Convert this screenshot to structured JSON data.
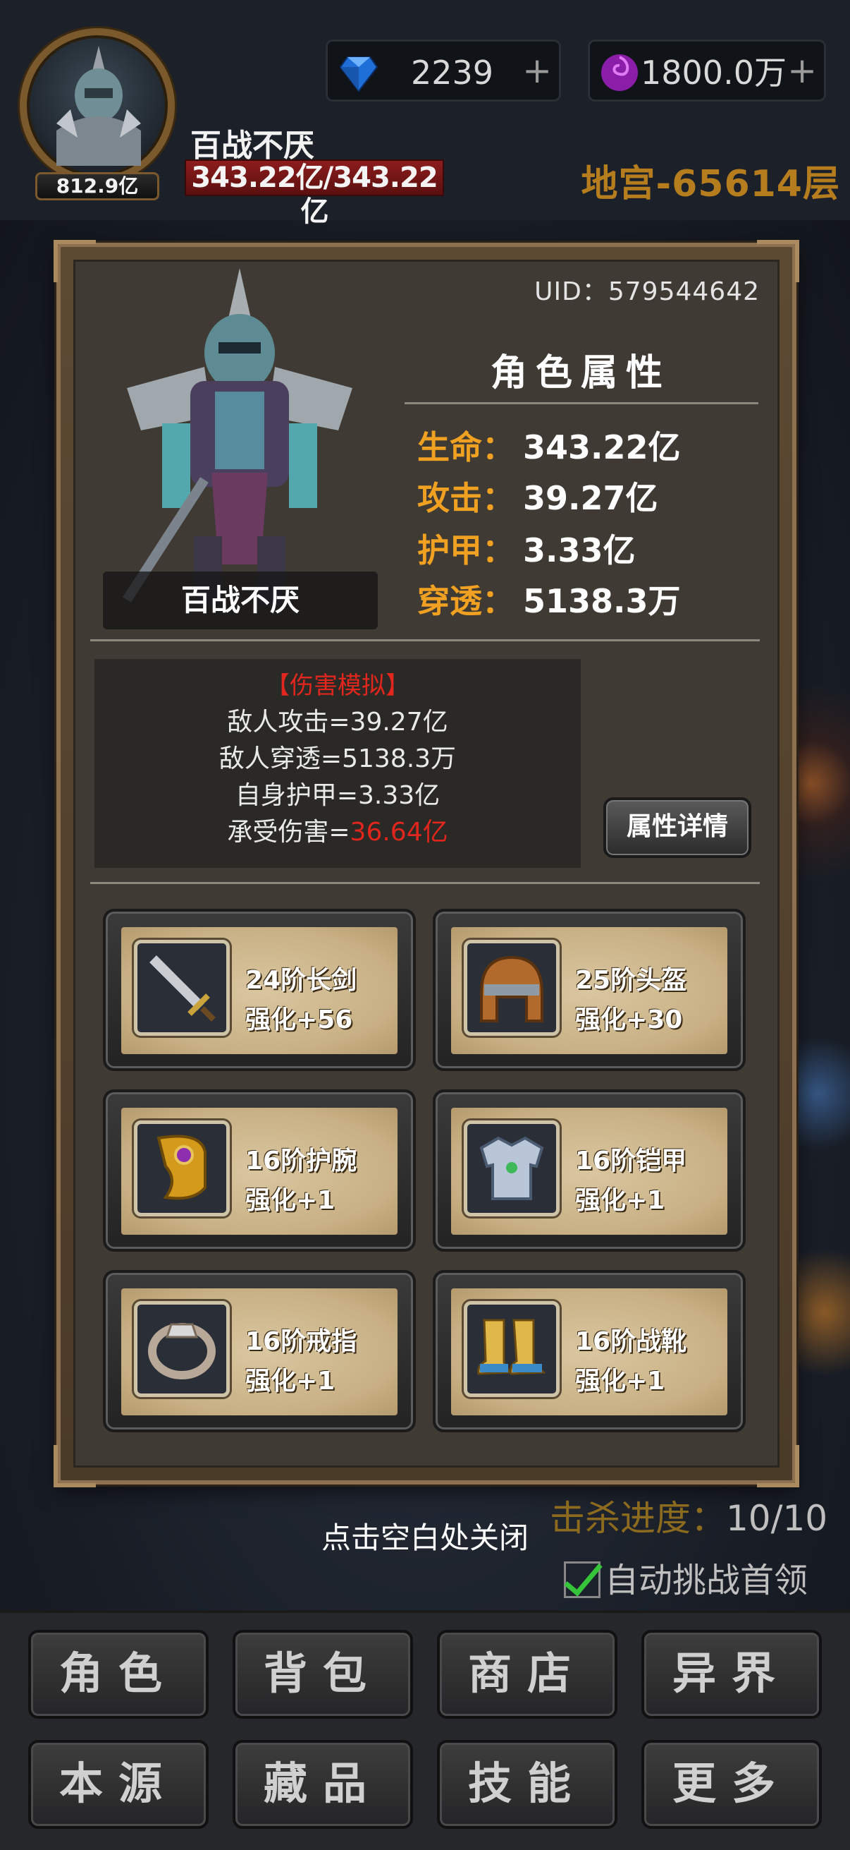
{
  "header": {
    "avatar_level": "812.9亿",
    "player_name": "百战不厌",
    "hp": "343.22亿/343.22亿",
    "gems": "2239",
    "gems_plus": "+",
    "essence": "1800.0万",
    "essence_plus": "+",
    "floor": "地宫-65614层"
  },
  "panel": {
    "uid": "UID：579544642",
    "hero_name": "百战不厌",
    "attr_title": "角色属性",
    "attributes": [
      {
        "label": "生命：",
        "value": "343.22亿"
      },
      {
        "label": "攻击：",
        "value": "39.27亿"
      },
      {
        "label": "护甲：",
        "value": "3.33亿"
      },
      {
        "label": "穿透：",
        "value": "5138.3万"
      }
    ],
    "damage_sim": {
      "title": "【伤害模拟】",
      "enemy_attack": "敌人攻击=39.27亿",
      "enemy_penetration": "敌人穿透=5138.3万",
      "self_armor": "自身护甲=3.33亿",
      "damage_label": "承受伤害=",
      "damage_value": "36.64亿"
    },
    "detail_button": "属性详情",
    "equipment": [
      {
        "name": "24阶长剑",
        "level": "强化+56",
        "icon": "sword-icon"
      },
      {
        "name": "25阶头盔",
        "level": "强化+30",
        "icon": "helmet-icon"
      },
      {
        "name": "16阶护腕",
        "level": "强化+1",
        "icon": "bracer-icon"
      },
      {
        "name": "16阶铠甲",
        "level": "强化+1",
        "icon": "armor-icon"
      },
      {
        "name": "16阶戒指",
        "level": "强化+1",
        "icon": "ring-icon"
      },
      {
        "name": "16阶战靴",
        "level": "强化+1",
        "icon": "boots-icon"
      }
    ]
  },
  "footer": {
    "kill_label": "击杀进度：",
    "kill_value": "10/10",
    "close_hint": "点击空白处关闭",
    "auto_challenge": "自动挑战首领",
    "auto_challenge_checked": true
  },
  "nav": [
    "角色",
    "背包",
    "商店",
    "异界",
    "本源",
    "藏品",
    "技能",
    "更多"
  ],
  "colors": {
    "accent_orange": "#f0a122",
    "damage_red": "#e0261d",
    "floor_gold": "#b57d1e",
    "check_green": "#36c43a"
  }
}
